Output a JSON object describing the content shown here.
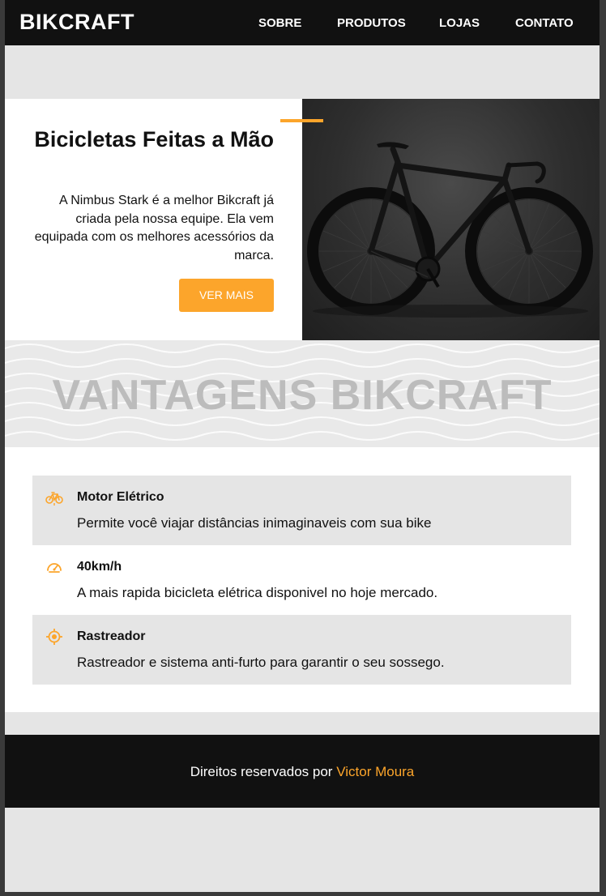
{
  "header": {
    "logo": "BIKCRAFT",
    "nav": [
      "SOBRE",
      "PRODUTOS",
      "LOJAS",
      "CONTATO"
    ]
  },
  "hero": {
    "title": "Bicicletas Feitas a Mão",
    "text": "A Nimbus Stark é a melhor Bikcraft já criada pela nossa equipe. Ela vem equipada com os melhores acessórios da marca.",
    "button": "VER MAIS",
    "image": "black road bicycle photo"
  },
  "advantages": {
    "title": "VANTAGENS BIKCRAFT",
    "items": [
      {
        "icon": "bike-icon",
        "title": "Motor Elétrico",
        "description": "Permite você viajar distâncias inimaginaveis com sua bike"
      },
      {
        "icon": "speedometer-icon",
        "title": "40km/h",
        "description": "A mais rapida bicicleta elétrica disponivel no hoje mercado."
      },
      {
        "icon": "target-icon",
        "title": "Rastreador",
        "description": "Rastreador e sistema anti-furto para garantir o seu sossego."
      }
    ]
  },
  "footer": {
    "text": "Direitos reservados por",
    "author": "Victor Moura"
  },
  "colors": {
    "accent": "#fca52b",
    "dark": "#111111",
    "light_gray": "#e5e5e5"
  }
}
